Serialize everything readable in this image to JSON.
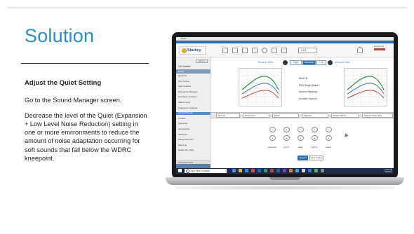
{
  "slide": {
    "title": "Solution",
    "heading": "Adjust the Quiet Setting",
    "paragraphs": [
      "Go to the Sound Manager screen.",
      "Decrease the level of the Quiet (Expansion + Low Level Noise Reduction) setting in one or more environments to reduce the amount of noise adaptation occurring for soft sounds that fall below the WDRC kneepoint."
    ],
    "accent_color": "#2a8ec2"
  },
  "app": {
    "window_title": "Inspire",
    "brand": "Starkey",
    "memory_select": "e 1/1",
    "connection_label": "Connected",
    "sidebar": {
      "button": "Sell icon",
      "heading": "Get Started",
      "bar": "Fitting",
      "items": [
        "Quick Fit",
        "Fine Tuning",
        "User Controls",
        "Experience Manager",
        "Feedback Canceller",
        "Patient Tests",
        "Frequency Lowering",
        "Sound Manager",
        "Tinnitus",
        "Memories",
        "Accessories",
        "Indicators",
        "Fitting Summary",
        "Data Log",
        "Ready Set, Hear"
      ],
      "selected_index": 7,
      "bottom": "Advanced Tools"
    },
    "left_side_label": "Evolv AI 2400",
    "right_side_label": "Evolv AI 2400",
    "sides": [
      "Right",
      "Binaural",
      "Left"
    ],
    "active_side": "Binaural",
    "links": [
      "Best Fit",
      "REM Target Match",
      "Speech Mapping",
      "Acoustic Options"
    ],
    "environments": [
      "Normal",
      "Restaurant",
      "Music",
      "Machine",
      "Stream Boost",
      "Stand Custom Env"
    ],
    "dials": [
      "Quietness",
      "Low Fr",
      "Gain",
      "High Fr",
      "Output"
    ],
    "buttons": {
      "primary": "Speech",
      "secondary": "Fine Tuning"
    },
    "taskbar_search": "Type here to search",
    "clock_time": "10:52 AM",
    "clock_date": "7/13/2021"
  }
}
